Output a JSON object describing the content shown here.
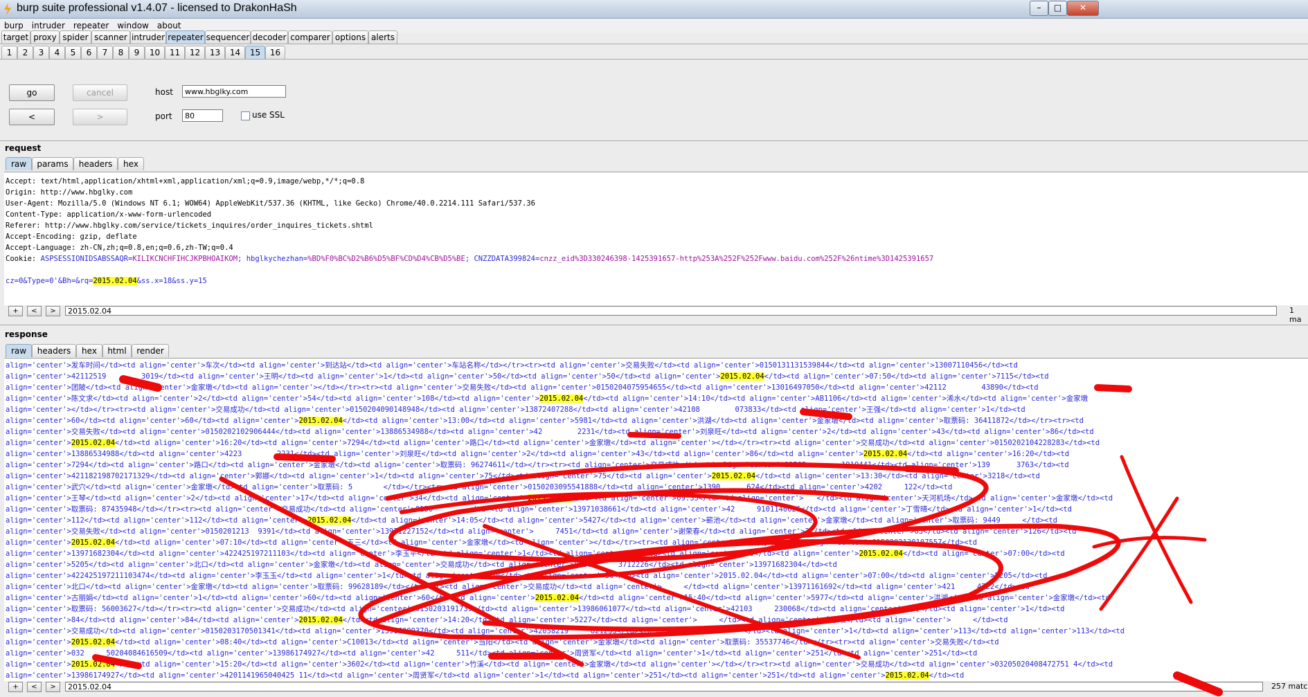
{
  "window": {
    "title": "burp suite professional v1.4.07 - licensed to DrakonHaSh"
  },
  "menu": [
    "burp",
    "intruder",
    "repeater",
    "window",
    "about"
  ],
  "tool_tabs": [
    "target",
    "proxy",
    "spider",
    "scanner",
    "intruder",
    "repeater",
    "sequencer",
    "decoder",
    "comparer",
    "options",
    "alerts"
  ],
  "selected_tool_tab": "repeater",
  "repeater_tabs": [
    "1",
    "2",
    "3",
    "4",
    "5",
    "6",
    "7",
    "8",
    "9",
    "10",
    "11",
    "12",
    "13",
    "14",
    "15",
    "16"
  ],
  "selected_repeater_tab": "15",
  "controls": {
    "go": "go",
    "cancel": "cancel",
    "back": "<",
    "forward": ">",
    "host_label": "host",
    "host_value": "www.hbglky.com",
    "port_label": "port",
    "port_value": "80",
    "ssl_label": "use SSL"
  },
  "request": {
    "title": "request",
    "tabs": [
      "raw",
      "params",
      "headers",
      "hex"
    ],
    "headers": [
      "Accept: text/html,application/xhtml+xml,application/xml;q=0.9,image/webp,*/*;q=0.8",
      "Origin: http://www.hbglky.com",
      "User-Agent: Mozilla/5.0 (Windows NT 6.1; WOW64) AppleWebKit/537.36 (KHTML, like Gecko) Chrome/40.0.2214.111 Safari/537.36",
      "Content-Type: application/x-www-form-urlencoded",
      "Referer: http://www.hbglky.com/service/tickets_inquires/order_inquires_tickets.shtml",
      "Accept-Encoding: gzip, deflate",
      "Accept-Language: zh-CN,zh;q=0.8,en;q=0.6,zh-TW;q=0.4"
    ],
    "cookie": {
      "label": "Cookie: ",
      "k1": "ASPSESSIONIDSABSSAQR",
      "v1": "KILIKCNCHFIHCJKPBHOAIKOM",
      "k2": "hbglkychezhan",
      "v2": "%BD%F0%BC%D2%B6%D5%BF%CD%D4%CB%D5%BE",
      "k3": "CNZZDATA399824",
      "v3": "cnzz_eid%3D330246398-1425391657-http%253A%252F%252Fwww.baidu.com%252F%26ntime%3D1425391657"
    },
    "body": {
      "pre": "cz=0&Type=0'&Bh=&rq=",
      "hl": "2015.02.04",
      "post": "&ss.x=18&ss.y=15"
    },
    "search": {
      "value": "2015.02.04",
      "matches": "1 ma"
    }
  },
  "response": {
    "title": "response",
    "tabs": [
      "raw",
      "headers",
      "hex",
      "html",
      "render"
    ],
    "lines": [
      [
        "align='center'>发车时间</td><td align='center'>车次</td><td align='center'>到达站</td><td align='center'>车站名称</td></tr><tr><td align='center'>交易失败</td><td align='center'>0150131131539844</td><td align='center'>13007110456</td><td"
      ],
      [
        "align='center'>42112519        3019</td><td align='center'>王明</td><td align='center'>1</td><td align='center'>50</td><td align='center'>50</td><td align='center'>",
        "2015.02.04",
        "</td><td align='center'>07:50</td><td align='center'>7115</td><td"
      ],
      [
        "align='center'>团陂</td><td align='center'>金家墩</td><td align='center'></td></tr><tr><td align='center'>交易失败</td><td align='center'>0150204075954655</td><td align='center'>13016497050</td><td align='center'>42112        43890</td><td"
      ],
      [
        "align='center'>陈文求</td><td align='center'>2</td><td align='center'>54</td><td align='center'>108</td><td align='center'>",
        "2015.02.04",
        "</td><td align='center'>14:10</td><td align='center'>AB1106</td><td align='center'>浠水</td><td align='center'>金家墩"
      ],
      [
        "align='center'></td></tr><tr><td align='center'>交易成功</td><td align='center'>0150204090148948</td><td align='center'>13872407288</td><td align='center'>42108        073833</td><td align='center'>王强</td><td align='center'>1</td><td"
      ],
      [
        "align='center'>60</td><td align='center'>60</td><td align='center'>",
        "2015.02.04",
        "</td><td align='center'>13:00</td><td align='center'>5981</td><td align='center'>洪湖</td><td align='center'>金家墩</td><td align='center'>取票码: 36411872</td></tr><tr><td"
      ],
      [
        "align='center'>交易失败</td><td align='center'>0150202102906444</td><td align='center'>13886534988</td><td align='center'>42        2231</td><td align='center'>刘泉旺</td><td align='center'>2</td><td align='center'>43</td><td align='center'>86</td><td"
      ],
      [
        "align='center'>",
        "2015.02.04",
        "</td><td align='center'>16:20</td><td align='center'>7294</td><td align='center'>路口</td><td align='center'>金家墩</td><td align='center'></td></tr><tr><td align='center'>交易成功</td><td align='center'>0150202104228283</td><td"
      ],
      [
        "align='center'>13886534988</td><td align='center'>4223        2231</td><td align='center'>刘泉旺</td><td align='center'>2</td><td align='center'>43</td><td align='center'>86</td><td align='center'>",
        "2015.02.04",
        "</td><td align='center'>16:20</td><td"
      ],
      [
        "align='center'>7294</td><td align='center'>路口</td><td align='center'>金家墩</td><td align='center'>取票码: 96274611</td></tr><tr><td align='center'>交易成功</td><td align='center'>01502        1919441</td><td align='center'>139      3763</td><td"
      ],
      [
        "align='center'>421182198702171329</td><td align='center'>郭娜</td><td align='center'>1</td><td align='center'>75</td><td align='center'>75</td><td align='center'>",
        "2015.02.04",
        "</td><td align='center'>13:30</td><td align='center'>3218</td><td"
      ],
      [
        "align='center'>武穴</td><td align='center'>金家墩</td><td align='center'>取票码: 5       </td></tr><tr><td align='center'>0150203095541888</td><td align='center'>1390      624</td><td align='center'>4202     122</td><td"
      ],
      [
        "align='center'>王琴</td><td align='center'>2</td><td align='center'>17</td><td align='center'>34</td><td align='center'>",
        "2015.02.04",
        "</td><td align='center'>09:35</td><td align='center'>   </td><td align='center'>天河机场</td><td align='center'>金家墩</td><td"
      ],
      [
        "align='center'>取票码: 87435948</td></tr><tr><td align='center'>交易成功</td><td align='center'>0150        </td><td align='center'>13971038661</td><td align='center'>42     9101140626</td><td align='center'>丁雪晴</td><td align='center'>1</td><td"
      ],
      [
        "align='center'>112</td><td align='center'>112</td><td align='center'>",
        "2015.02.04",
        "</td><td align='center'>14:05</td><td align='center'>5427</td><td align='center'>蕲池</td><td align='center'>金家墩</td><td align='center'>取票码: 9449     </td><td"
      ],
      [
        "align='center'>交易失败</td><td align='center'>0150201213  9391</td><td align='center'>13971227152</td><td align='center'>     7451</td><td align='center'>谢荣春</td><td align='center'>2</td><td align='center'>63</td><td align='center'>126</td><td"
      ],
      [
        "align='center'>",
        "2015.02.04",
        "</td><td align='center'>07:10</td><td align='center'>五三</td><td align='center'>金家墩</td><td align='center'></td></tr><tr><td align='center'>交易成功</td><td align='center'>0150203130107557</td><td"
      ],
      [
        "align='center'>13971682304</td><td align='center'>422425197211103</td><td align='center'>李玉平</td><td align='center'>1</td><td align='center'>50</td><td align='center'>50</td><td align='center'>",
        "2015.02.04",
        "</td><td align='center'>07:00</td><td"
      ],
      [
        "align='center'>5205</td><td align='center'>北口</td><td align='center'>金家墩</td><td align='center'>交易成功</td><td align='center'>01502     3712226</td><td align='center'>13971682304</td><td"
      ],
      [
        "align='center'>422425197211103474</td><td align='center'>李玉玉</td><td align='center'>1</td><td align='center'>50</td><td align='center'>50</td><td align='center'>2015.02.04</td><td align='center'>07:00</td><td align='center'>5205</td><td"
      ],
      [
        "align='center'>北口</td><td align='center'>金家墩</td><td align='center'>取票码: 99628189</td></tr><tr><td align='center'>交易成功</td><td align='center'>     </td><td align='center'>13971161692</td><td align='center'>421     4722</td><td"
      ],
      [
        "align='center'>古丽娟</td><td align='center'>1</td><td align='center'>60</td><td align='center'>60</td><td align='center'>",
        "2015.02.04",
        "</td><td align='center'>15:40</td><td align='center'>5977</td><td align='center'>洪湖</td><td align='center'>金家墩</td><td"
      ],
      [
        "align='center'>取票码: 56003627</td></tr><tr><td align='center'>交易成功</td><td align='center'>0150203191739</td><td align='center'>13986061077</td><td align='center'>42103     230068</td><td align='center'>白玲</td><td align='center'>1</td><td"
      ],
      [
        "align='center'>84</td><td align='center'>84</td><td align='center'>",
        "2015.02.04",
        "</td><td align='center'>14:20</td><td align='center'>5227</td><td align='center'>     </td><td align='center'>金家墩</td><td align='center'>     </td><td"
      ],
      [
        "align='center'>交易成功</td><td align='center'>0150203170501341</td><td align='center'>13986099370</td><td align='center'>42058219     821233</td><td align='center'>     </td><td align='center'>1</td><td align='center'>113</td><td align='center'>113</td><td"
      ],
      [
        "align='center'>",
        "2015.02.04",
        "</td><td align='center'>08:40</td><td align='center'>C10013</td><td align='center'>当阳</td><td align='center'>金家墩</td><td align='center'>取票码: 35537746</td></tr><tr><td align='center'>交易失败</td><td"
      ],
      [
        "align='center'>032     50204084616509</td><td align='center'>13986174927</td><td align='center'>42     511</td><td align='center'>周贤军</td><td align='center'>1</td><td align='center'>251</td><td align='center'>251</td><td"
      ],
      [
        "align='center'>",
        "2015.02.04",
        "</td><td align='center'>15:20</td><td align='center'>3602</td><td align='center'>竹溪</td><td align='center'>金家墩</td><td align='center'></td></tr><tr><td align='center'>交易成功</td><td align='center'>03205020408472751 4</td><td"
      ],
      [
        "align='center'>13986174927</td><td align='center'>4201141965040425 11</td><td align='center'>周贤军</td><td align='center'>1</td><td align='center'>251</td><td align='center'>251</td><td align='center'>",
        "2015.02.04",
        "</td><td"
      ]
    ],
    "search": {
      "value": "2015.02.04",
      "matches": "257 matc"
    }
  }
}
